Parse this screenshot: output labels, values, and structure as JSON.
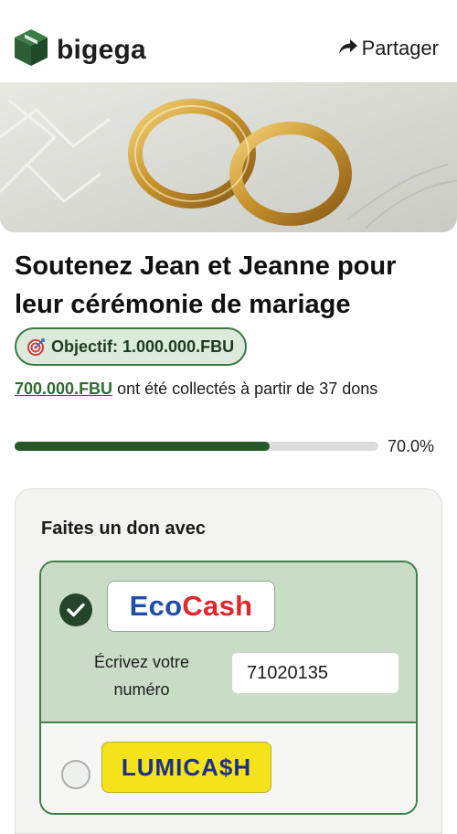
{
  "brand": {
    "name": "bigega",
    "accent": "#25592a"
  },
  "header": {
    "share_label": "Partager"
  },
  "campaign": {
    "title": "Soutenez Jean et Jeanne pour leur cérémonie de mariage",
    "goal_label": "Objectif: 1.000.000.FBU",
    "raised_amount": "700.000.FBU",
    "raised_text": " ont été collectés à partir de 37 dons",
    "progress": 0.7,
    "progress_label": "70.0%"
  },
  "donate": {
    "title": "Faites un don avec",
    "methods": [
      {
        "name": "EcoCash",
        "logo_part1": "Eco",
        "logo_part2": "Cash",
        "selected": true,
        "phone_label": "Écrivez votre numéro",
        "phone_value": "71020135"
      },
      {
        "name": "LUMICASH",
        "logo_text": "LUMICA$H",
        "selected": false
      }
    ]
  },
  "icons": {
    "logo": "box-logo-icon",
    "share": "share-arrow-icon",
    "goal": "target-icon",
    "selected": "check-circle-icon",
    "unselected": "radio-empty-icon"
  }
}
